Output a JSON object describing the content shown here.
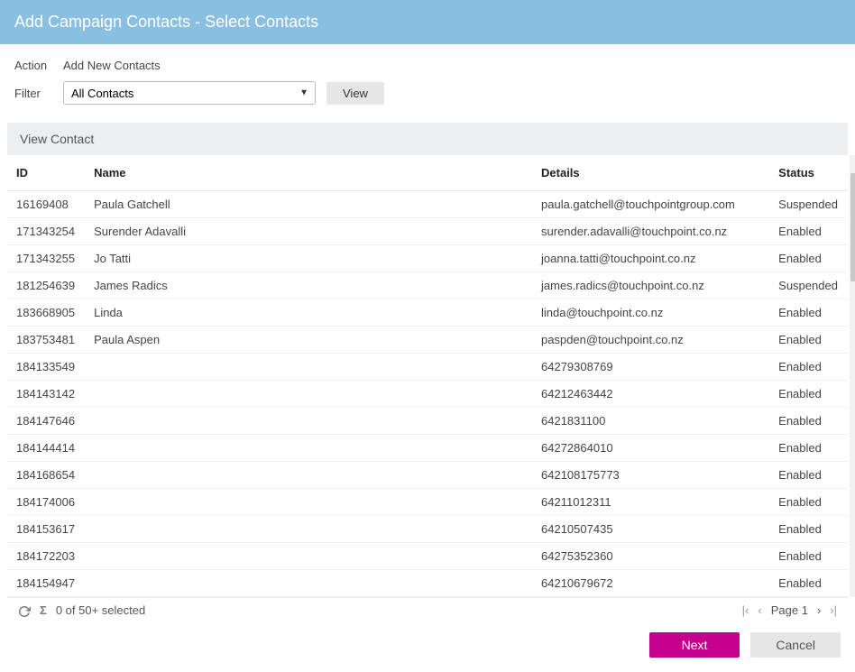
{
  "title": "Add Campaign Contacts - Select Contacts",
  "controls": {
    "action_label": "Action",
    "action_link": "Add New Contacts",
    "filter_label": "Filter",
    "filter_value": "All Contacts",
    "view_btn": "View"
  },
  "section_header": "View Contact",
  "columns": {
    "id": "ID",
    "name": "Name",
    "details": "Details",
    "status": "Status"
  },
  "rows": [
    {
      "id": "16169408",
      "name": "Paula Gatchell",
      "details": "paula.gatchell@touchpointgroup.com",
      "status": "Suspended"
    },
    {
      "id": "171343254",
      "name": "Surender Adavalli",
      "details": "surender.adavalli@touchpoint.co.nz",
      "status": "Enabled"
    },
    {
      "id": "171343255",
      "name": "Jo Tatti",
      "details": "joanna.tatti@touchpoint.co.nz",
      "status": "Enabled"
    },
    {
      "id": "181254639",
      "name": "James Radics",
      "details": "james.radics@touchpoint.co.nz",
      "status": "Suspended"
    },
    {
      "id": "183668905",
      "name": "Linda",
      "details": "linda@touchpoint.co.nz",
      "status": "Enabled"
    },
    {
      "id": "183753481",
      "name": "Paula Aspen",
      "details": "paspden@touchpoint.co.nz",
      "status": "Enabled"
    },
    {
      "id": "184133549",
      "name": "",
      "details": "64279308769",
      "status": "Enabled"
    },
    {
      "id": "184143142",
      "name": "",
      "details": "64212463442",
      "status": "Enabled"
    },
    {
      "id": "184147646",
      "name": "",
      "details": "6421831100",
      "status": "Enabled"
    },
    {
      "id": "184144414",
      "name": "",
      "details": "64272864010",
      "status": "Enabled"
    },
    {
      "id": "184168654",
      "name": "",
      "details": "642108175773",
      "status": "Enabled"
    },
    {
      "id": "184174006",
      "name": "",
      "details": "64211012311",
      "status": "Enabled"
    },
    {
      "id": "184153617",
      "name": "",
      "details": "64210507435",
      "status": "Enabled"
    },
    {
      "id": "184172203",
      "name": "",
      "details": "64275352360",
      "status": "Enabled"
    },
    {
      "id": "184154947",
      "name": "",
      "details": "64210679672",
      "status": "Enabled"
    }
  ],
  "footer": {
    "selected_text": "0 of 50+ selected",
    "page_label": "Page 1"
  },
  "buttons": {
    "next": "Next",
    "cancel": "Cancel"
  }
}
